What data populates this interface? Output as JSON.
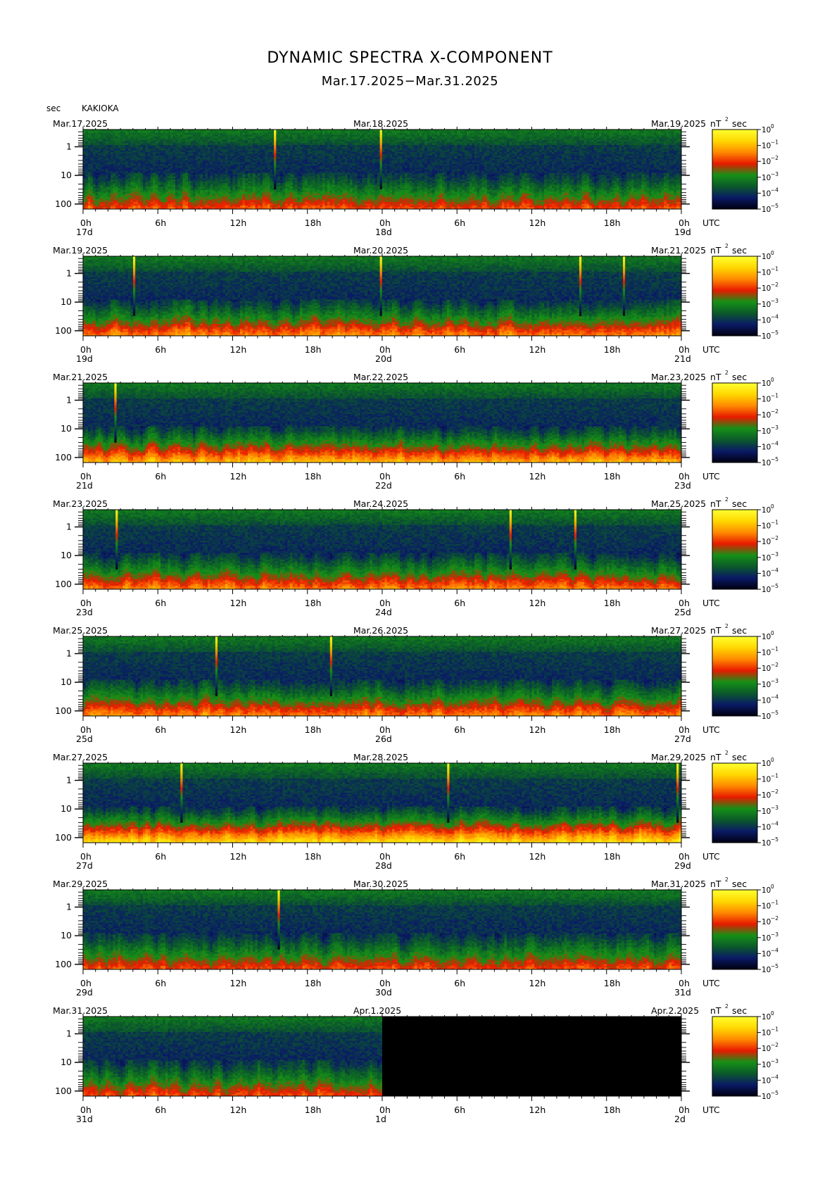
{
  "title": "DYNAMIC SPECTRA X-COMPONENT",
  "subtitle": "Mar.17.2025−Mar.31.2025",
  "unit_label": "sec",
  "station": "KAKIOKA",
  "colors": {
    "scale": [
      "#000010",
      "#0a1a66",
      "#0b5a2a",
      "#169016",
      "#e81a00",
      "#ff8a00",
      "#ffd800",
      "#ffff30"
    ],
    "no_data": "#000000"
  },
  "chart_data": {
    "type": "heatmap",
    "x_tick_labels": [
      "0h",
      "6h",
      "12h",
      "18h",
      "0h",
      "6h",
      "12h",
      "18h",
      "0h"
    ],
    "x_unit": "UTC",
    "y_tick_labels": [
      "1",
      "10",
      "100"
    ],
    "y_unit": "sec",
    "y_scale": "log",
    "colorbar_unit": "nT",
    "colorbar_unit_exp": "2",
    "colorbar_unit_tail": "sec",
    "colorbar_labels": [
      "10",
      "10",
      "10",
      "10",
      "10",
      "10"
    ],
    "colorbar_exps": [
      "0",
      "−1",
      "−2",
      "−3",
      "−4",
      "−5"
    ],
    "panels": [
      {
        "date_left": "Mar.17.2025",
        "date_mid": "Mar.18.2025",
        "date_right": "Mar.19.2025",
        "day_labels": [
          "17d",
          "18d",
          "19d"
        ],
        "bursts": [
          15.4,
          23.9
        ],
        "activity": "quiet",
        "no_data_from": null
      },
      {
        "date_left": "Mar.19.2025",
        "date_mid": "Mar.20.2025",
        "date_right": "Mar.21.2025",
        "day_labels": [
          "19d",
          "20d",
          "21d"
        ],
        "bursts": [
          4.1,
          23.9,
          39.9,
          43.4
        ],
        "activity": "moderate",
        "no_data_from": null
      },
      {
        "date_left": "Mar.21.2025",
        "date_mid": "Mar.22.2025",
        "date_right": "Mar.23.2025",
        "day_labels": [
          "21d",
          "22d",
          "23d"
        ],
        "bursts": [
          2.6
        ],
        "activity": "active",
        "no_data_from": null
      },
      {
        "date_left": "Mar.23.2025",
        "date_mid": "Mar.24.2025",
        "date_right": "Mar.25.2025",
        "day_labels": [
          "23d",
          "24d",
          "25d"
        ],
        "bursts": [
          2.7,
          34.3,
          39.5
        ],
        "activity": "moderate",
        "no_data_from": null
      },
      {
        "date_left": "Mar.25.2025",
        "date_mid": "Mar.26.2025",
        "date_right": "Mar.27.2025",
        "day_labels": [
          "25d",
          "26d",
          "27d"
        ],
        "bursts": [
          10.7,
          19.9
        ],
        "activity": "moderate",
        "no_data_from": null
      },
      {
        "date_left": "Mar.27.2025",
        "date_mid": "Mar.28.2025",
        "date_right": "Mar.29.2025",
        "day_labels": [
          "27d",
          "28d",
          "29d"
        ],
        "bursts": [
          7.9,
          29.3,
          47.7
        ],
        "activity": "storm",
        "no_data_from": null
      },
      {
        "date_left": "Mar.29.2025",
        "date_mid": "Mar.30.2025",
        "date_right": "Mar.31.2025",
        "day_labels": [
          "29d",
          "30d",
          "31d"
        ],
        "bursts": [
          15.7
        ],
        "activity": "quiet",
        "no_data_from": null
      },
      {
        "date_left": "Mar.31.2025",
        "date_mid": "Apr.1.2025",
        "date_right": "Apr.2.2025",
        "day_labels": [
          "31d",
          "1d",
          "2d"
        ],
        "bursts": [],
        "activity": "quiet",
        "no_data_from": 24
      }
    ]
  }
}
